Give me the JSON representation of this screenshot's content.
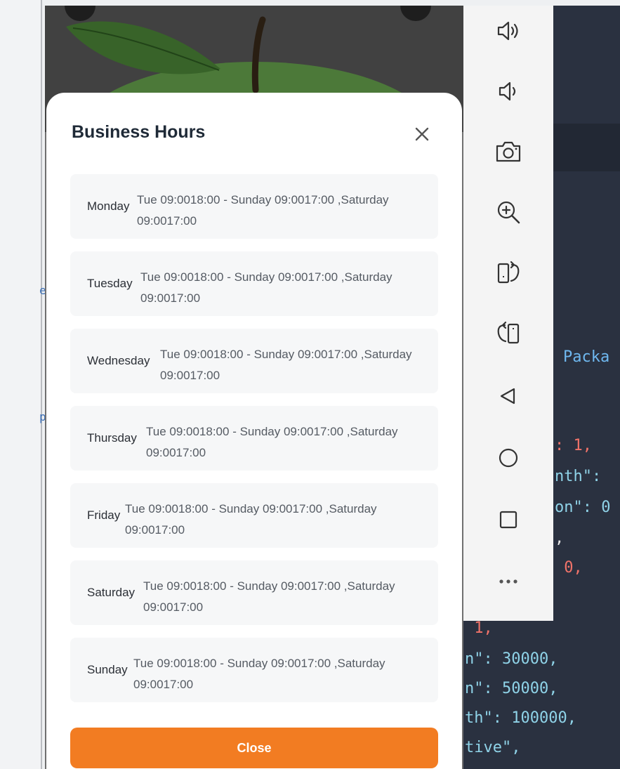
{
  "modal": {
    "title": "Business Hours",
    "close_label": "Close",
    "hours": [
      {
        "day": "Monday",
        "line1": "Tue 09:0018:00 - Sunday 09:0017:00 ,Saturday",
        "line2": "09:0017:00"
      },
      {
        "day": "Tuesday",
        "line1": "Tue 09:0018:00 - Sunday 09:0017:00 ,Saturday",
        "line2": "09:0017:00"
      },
      {
        "day": "Wednesday",
        "line1": "Tue 09:0018:00 - Sunday 09:0017:00 ,Saturday",
        "line2": "09:0017:00"
      },
      {
        "day": "Thursday",
        "line1": "Tue 09:0018:00 - Sunday 09:0017:00 ,Saturday",
        "line2": "09:0017:00"
      },
      {
        "day": "Friday",
        "line1": "Tue 09:0018:00 - Sunday 09:0017:00 ,Saturday",
        "line2": "09:0017:00"
      },
      {
        "day": "Saturday",
        "line1": "Tue 09:0018:00 - Sunday 09:0017:00 ,Saturday",
        "line2": "09:0017:00"
      },
      {
        "day": "Sunday",
        "line1": "Tue 09:0018:00 - Sunday 09:0017:00 ,Saturday",
        "line2": "09:0017:00"
      }
    ]
  },
  "toolbar": {
    "buttons": [
      "volume-up-icon",
      "volume-down-icon",
      "camera-icon",
      "zoom-in-icon",
      "rotate-right-icon",
      "rotate-left-icon",
      "back-icon",
      "home-icon",
      "overview-icon",
      "more-icon"
    ]
  },
  "editor": {
    "lines": [
      {
        "text": "Packa",
        "cls": "b"
      },
      {
        "text": ": 1,",
        "cls": "n"
      },
      {
        "text": "nth\": ",
        "cls": "s"
      },
      {
        "text": "on\": 0",
        "cls": "s"
      },
      {
        "text": ",",
        "cls": "k"
      },
      {
        "text": " 0,",
        "cls": "n"
      },
      {
        "text": " 1,",
        "cls": "n"
      },
      {
        "text": "n\": 30000,",
        "cls": "s"
      },
      {
        "text": "n\": 50000,",
        "cls": "s"
      },
      {
        "text": "th\": 100000,",
        "cls": "s"
      },
      {
        "text": "tive\",",
        "cls": "s"
      }
    ]
  },
  "colors": {
    "accent": "#f27c22",
    "title": "#1f2a37",
    "row_bg": "#f6f7f8",
    "editor_bg": "#2a3140"
  }
}
